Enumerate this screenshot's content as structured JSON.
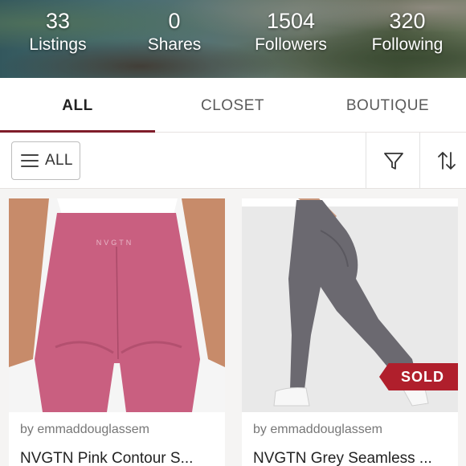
{
  "stats": [
    {
      "value": "33",
      "label": "Listings"
    },
    {
      "value": "0",
      "label": "Shares"
    },
    {
      "value": "1504",
      "label": "Followers"
    },
    {
      "value": "320",
      "label": "Following"
    }
  ],
  "tabs": [
    {
      "label": "ALL",
      "active": true
    },
    {
      "label": "CLOSET",
      "active": false
    },
    {
      "label": "BOUTIQUE",
      "active": false
    }
  ],
  "filter_bar": {
    "all_label": "ALL",
    "filter_icon": "filter-funnel-icon",
    "sort_icon": "sort-arrows-icon"
  },
  "listings": [
    {
      "seller": "by emmaddouglassem",
      "title": "NVGTN Pink Contour S...",
      "brand_mark": "NVGTN",
      "sold": false
    },
    {
      "seller": "by emmaddouglassem",
      "title": "NVGTN Grey Seamless ...",
      "sold": true,
      "sold_label": "SOLD"
    }
  ],
  "colors": {
    "accent": "#7f1d2a",
    "sold_badge": "#b01f2c",
    "pink_leggings": "#c95f80",
    "grey_leggings": "#6b6970"
  }
}
